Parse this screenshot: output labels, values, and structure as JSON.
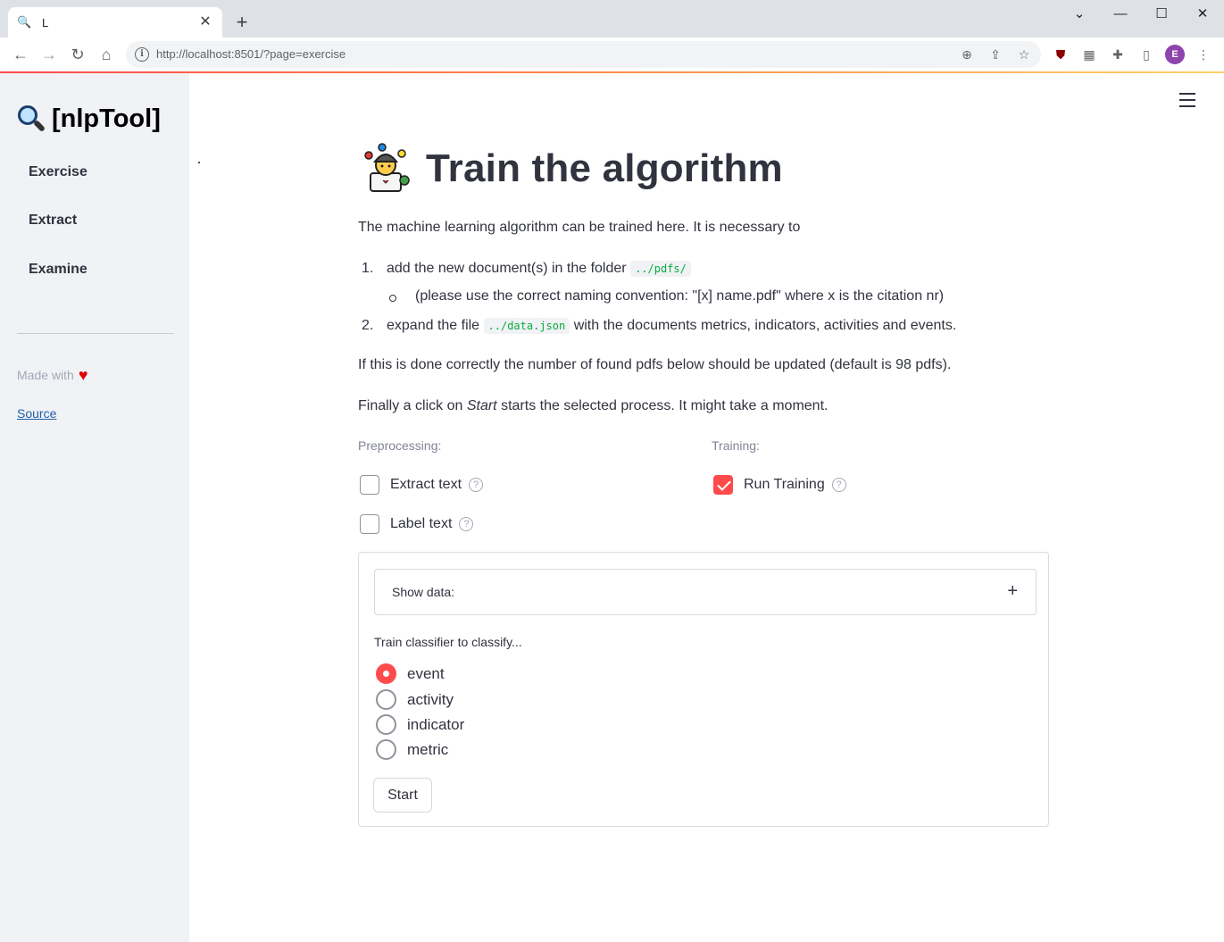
{
  "browser": {
    "tab_title": "L",
    "url": "http://localhost:8501/?page=exercise",
    "profile_initial": "E"
  },
  "sidebar": {
    "brand": "[nlpTool]",
    "items": [
      {
        "label": "Exercise"
      },
      {
        "label": "Extract"
      },
      {
        "label": "Examine"
      }
    ],
    "made_with": "Made with",
    "source_link": "Source"
  },
  "main": {
    "title": "Train the algorithm",
    "intro": "The machine learning algorithm can be trained here. It is necessary to",
    "list": {
      "item1_num": "1.",
      "item1_text": "add the new document(s) in the folder",
      "item1_code": "../pdfs/",
      "item1_sub": "(please use the correct naming convention: \"[x] name.pdf\" where x is the citation nr)",
      "item2_num": "2.",
      "item2_text_a": "expand the file",
      "item2_code": "../data.json",
      "item2_text_b": "with the documents metrics, indicators, activities and events."
    },
    "note": "If this is done correctly the number of found pdfs below should be updated (default is 98 pdfs).",
    "finally_a": "Finally a click on ",
    "finally_em": "Start",
    "finally_b": " starts the selected process. It might take a moment.",
    "preprocessing_label": "Preprocessing:",
    "training_label": "Training:",
    "checkboxes": {
      "extract_text": {
        "label": "Extract text",
        "checked": false
      },
      "label_text": {
        "label": "Label text",
        "checked": false
      },
      "run_training": {
        "label": "Run Training",
        "checked": true
      }
    },
    "form": {
      "expander_label": "Show data:",
      "radio_label": "Train classifier to classify...",
      "options": [
        "event",
        "activity",
        "indicator",
        "metric"
      ],
      "selected": "event",
      "start_button": "Start"
    }
  },
  "colors": {
    "accent": "#ff4b4b",
    "sidebar_bg": "#f0f2f6",
    "text": "#31333f",
    "code_green": "#09ab3b"
  }
}
